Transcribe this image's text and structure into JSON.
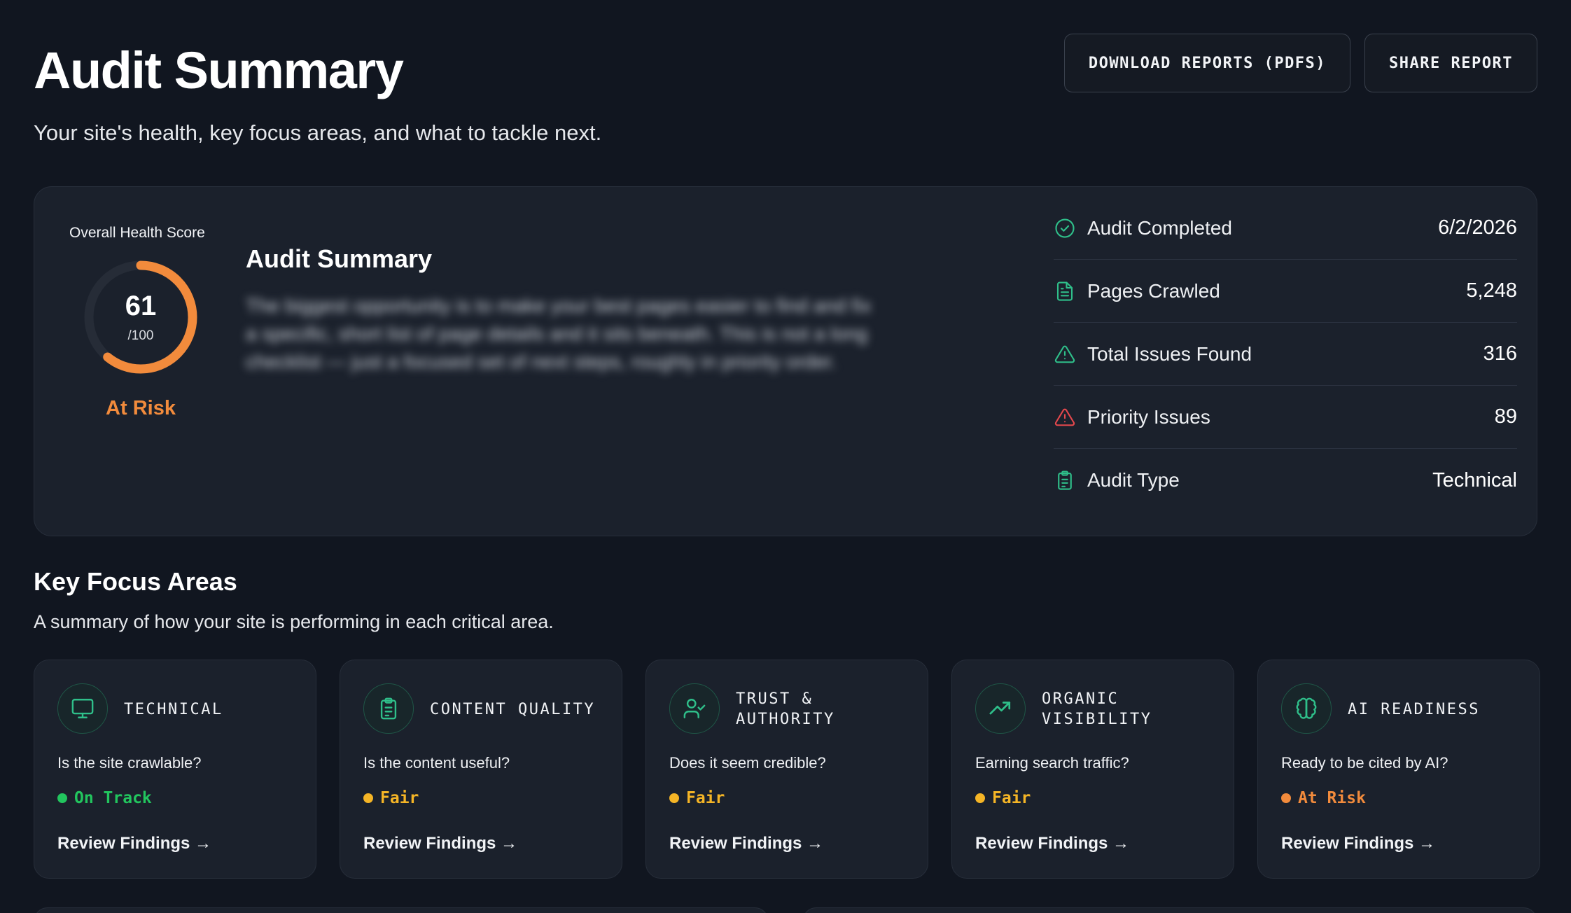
{
  "header": {
    "title": "Audit Summary",
    "subtitle": "Your site's health, key focus areas, and what to tackle next.",
    "download_label": "DOWNLOAD REPORTS (PDFS)",
    "share_label": "SHARE REPORT"
  },
  "summary": {
    "score_label": "Overall Health Score",
    "score": "61",
    "score_max": "/100",
    "score_fraction": 0.61,
    "status": "At Risk",
    "heading": "Audit Summary",
    "body": "The biggest opportunity is to make your best pages easier to find and fix a specific, short list of page details and it sits beneath. This is not a long checklist — just a focused set of next steps, roughly in priority order.",
    "stats": [
      {
        "label": "Audit Completed",
        "value": "6/2/2026",
        "icon": "check-circle-icon"
      },
      {
        "label": "Pages Crawled",
        "value": "5,248",
        "icon": "document-icon"
      },
      {
        "label": "Total Issues Found",
        "value": "316",
        "icon": "warning-triangle-icon"
      },
      {
        "label": "Priority Issues",
        "value": "89",
        "icon": "alert-triangle-icon"
      },
      {
        "label": "Audit Type",
        "value": "Technical",
        "icon": "clipboard-icon"
      }
    ]
  },
  "focus": {
    "title": "Key Focus Areas",
    "subtitle": "A summary of how your site is performing in each critical area.",
    "cards": [
      {
        "title": "TECHNICAL",
        "question": "Is the site crawlable?",
        "status": "On Track",
        "link": "Review Findings →",
        "icon": "monitor-icon"
      },
      {
        "title": "CONTENT QUALITY",
        "question": "Is the content useful?",
        "status": "Fair",
        "link": "Review Findings →",
        "icon": "clipboard-icon"
      },
      {
        "title": "TRUST & AUTHORITY",
        "question": "Does it seem credible?",
        "status": "Fair",
        "link": "Review Findings →",
        "icon": "user-check-icon"
      },
      {
        "title": "ORGANIC VISIBILITY",
        "question": "Earning search traffic?",
        "status": "Fair",
        "link": "Review Findings →",
        "icon": "trending-up-icon"
      },
      {
        "title": "AI READINESS",
        "question": "Ready to be cited by AI?",
        "status": "At Risk",
        "link": "Review Findings →",
        "icon": "brain-icon"
      }
    ]
  },
  "colors": {
    "accent_green": "#2fbf8a",
    "on_track": "#22c55e",
    "fair": "#f5b526",
    "at_risk": "#f28b3c",
    "danger": "#e5484d"
  }
}
